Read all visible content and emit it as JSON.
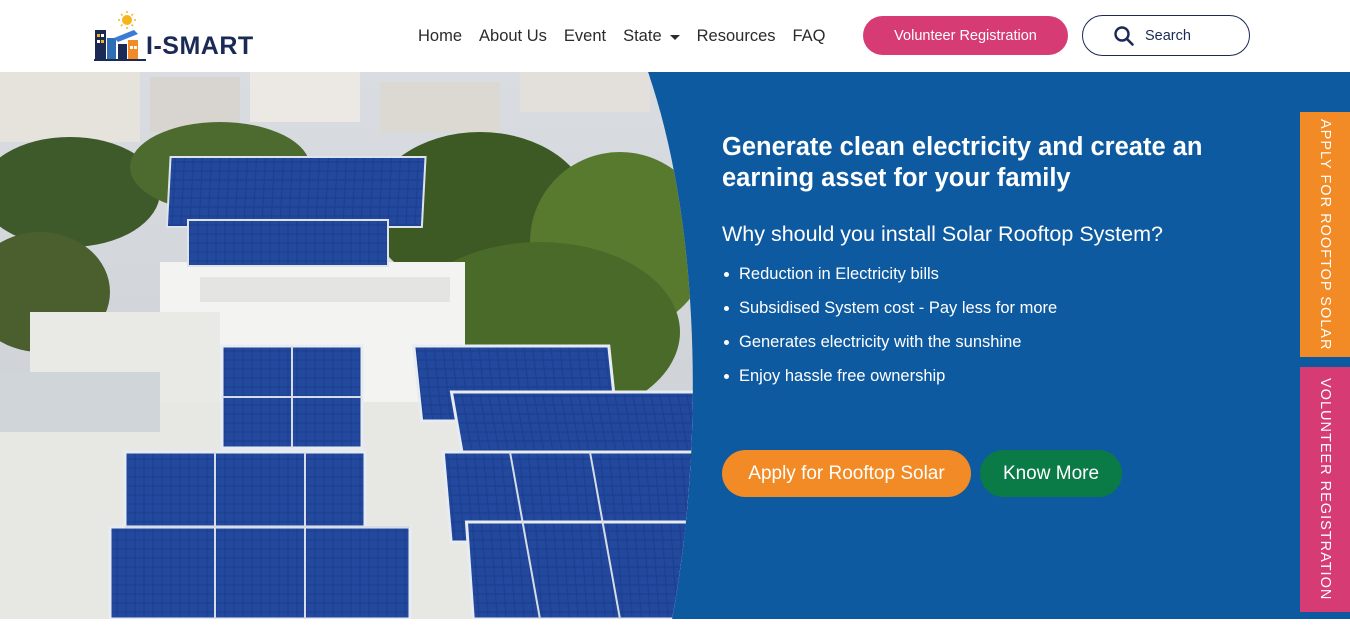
{
  "brand": {
    "name": "I-SMART",
    "colors": {
      "navy": "#1b2a55",
      "blue": "#0e5aa0",
      "pink": "#d63c73",
      "orange": "#f28a25",
      "green": "#0a7a46"
    }
  },
  "nav": {
    "items": [
      {
        "label": "Home"
      },
      {
        "label": "About Us"
      },
      {
        "label": "Event"
      },
      {
        "label": "State",
        "has_dropdown": true
      },
      {
        "label": "Resources"
      },
      {
        "label": "FAQ"
      }
    ],
    "volunteer_button": "Volunteer Registration",
    "search": {
      "placeholder": "Search",
      "icon": "search-icon"
    }
  },
  "hero": {
    "headline": "Generate clean electricity and create an earning asset for your family",
    "subheading": "Why should you install Solar Rooftop System?",
    "benefits": [
      "Reduction in Electricity bills",
      "Subsidised System cost - Pay less for more",
      "Generates electricity with the sunshine",
      "Enjoy hassle free ownership"
    ],
    "cta_primary": "Apply for Rooftop Solar",
    "cta_secondary": "Know More",
    "image": "rooftop solar panels on buildings"
  },
  "side_tabs": {
    "apply": "APPLY FOR ROOFTOP SOLAR",
    "volunteer": "VOLUNTEER REGISTRATION"
  }
}
